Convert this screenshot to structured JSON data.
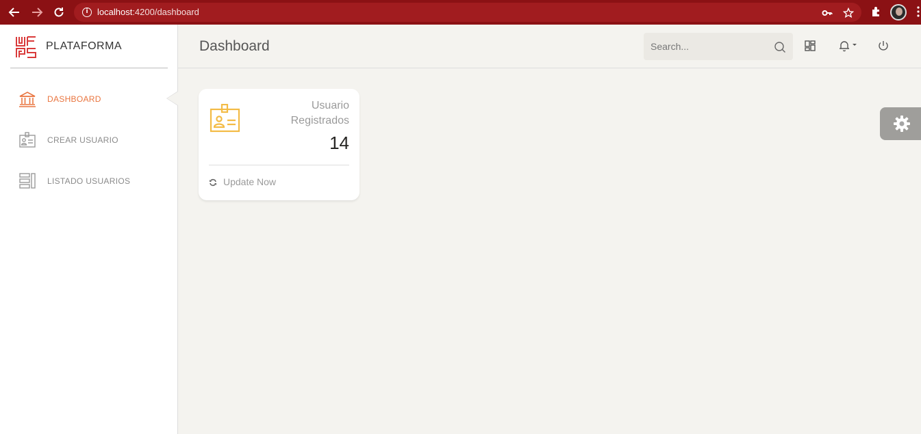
{
  "browser": {
    "url_host": "localhost",
    "url_rest": ":4200/dashboard"
  },
  "sidebar": {
    "brand": "PLATAFORMA",
    "items": [
      {
        "label": "DASHBOARD",
        "icon": "bank-icon",
        "active": true
      },
      {
        "label": "CREAR USUARIO",
        "icon": "badge-icon",
        "active": false
      },
      {
        "label": "LISTADO USUARIOS",
        "icon": "list-icon",
        "active": false
      }
    ]
  },
  "header": {
    "title": "Dashboard",
    "search_placeholder": "Search..."
  },
  "stat_card": {
    "category_line1": "Usuario",
    "category_line2": "Registrados",
    "value": "14",
    "footer": "Update Now"
  },
  "colors": {
    "browser_bar": "#8b1114",
    "accent": "#e9743e",
    "card_icon": "#f3bb45",
    "background": "#f4f3ef"
  }
}
